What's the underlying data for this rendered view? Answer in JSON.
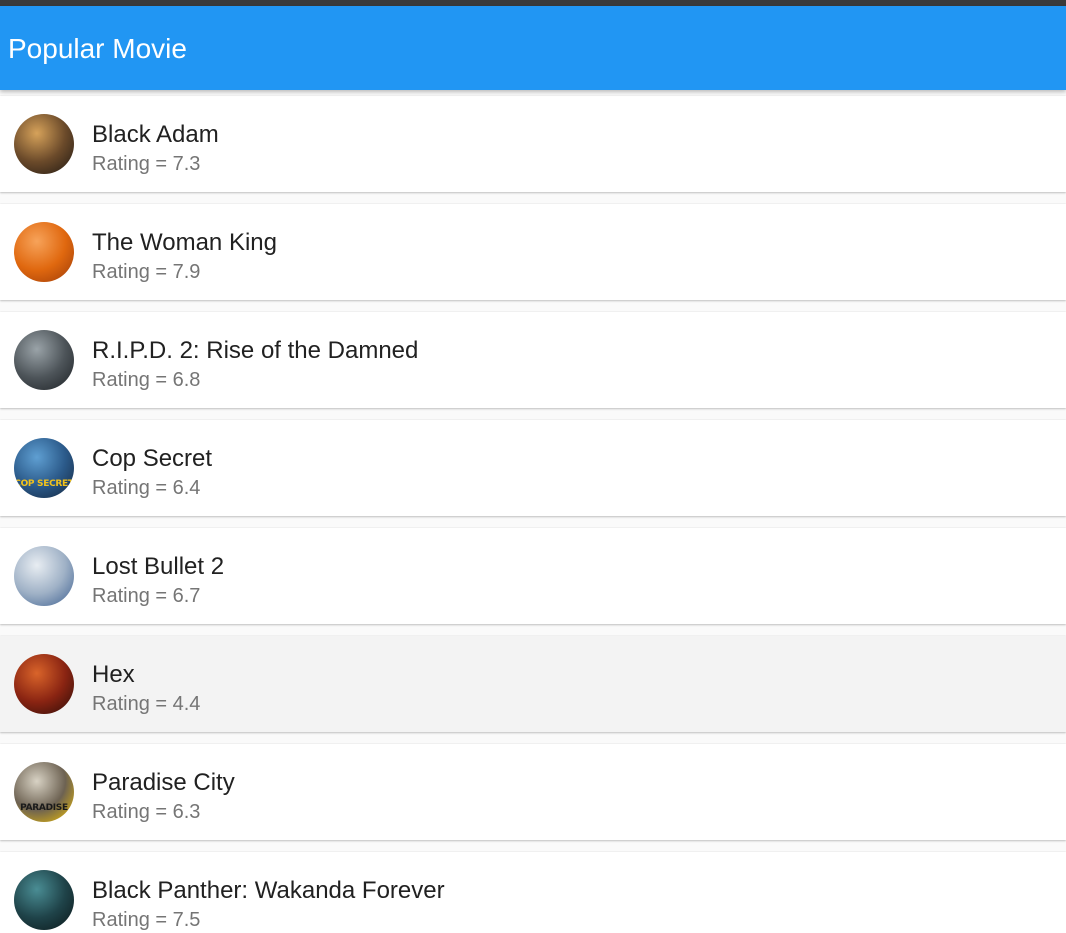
{
  "app_bar": {
    "title": "Popular Movie",
    "color": "#2196f3"
  },
  "movies": [
    {
      "title": "Black Adam",
      "rating_prefix": "Rating = ",
      "rating": "7.3",
      "poster_icon": "movie-poster-black-adam",
      "poster_colors": [
        "#d6a25a",
        "#6b4a2a",
        "#1e1712"
      ]
    },
    {
      "title": "The Woman King",
      "rating_prefix": "Rating = ",
      "rating": "7.9",
      "poster_icon": "movie-poster-the-woman-king",
      "poster_colors": [
        "#f7a35a",
        "#e0680f",
        "#9c3a08"
      ]
    },
    {
      "title": "R.I.P.D. 2: Rise of the Damned",
      "rating_prefix": "Rating = ",
      "rating": "6.8",
      "poster_icon": "movie-poster-ripd-2",
      "poster_colors": [
        "#9aa3a8",
        "#4d5459",
        "#1c2024"
      ]
    },
    {
      "title": "Cop Secret",
      "rating_prefix": "Rating = ",
      "rating": "6.4",
      "poster_icon": "movie-poster-cop-secret",
      "poster_colors": [
        "#5f9fd2",
        "#2b5a8a",
        "#14253d"
      ],
      "poster_text": "COP SECRET",
      "poster_text_color": "#f3c21b"
    },
    {
      "title": "Lost Bullet 2",
      "rating_prefix": "Rating = ",
      "rating": "6.7",
      "poster_icon": "movie-poster-lost-bullet-2",
      "poster_colors": [
        "#e8edf2",
        "#9fb1c6",
        "#3b5e8f"
      ]
    },
    {
      "title": "Hex",
      "rating_prefix": "Rating = ",
      "rating": "4.4",
      "poster_icon": "movie-poster-hex",
      "poster_colors": [
        "#d9642a",
        "#8a2412",
        "#2a0c08"
      ],
      "highlighted": true
    },
    {
      "title": "Paradise City",
      "rating_prefix": "Rating = ",
      "rating": "6.3",
      "poster_icon": "movie-poster-paradise-city",
      "poster_colors": [
        "#d8d2c4",
        "#6d6252",
        "#f5c400"
      ],
      "poster_text": "PARADISE",
      "poster_text_color": "#1a1a1a"
    },
    {
      "title": "Black Panther: Wakanda Forever",
      "rating_prefix": "Rating = ",
      "rating": "7.5",
      "poster_icon": "movie-poster-black-panther-wakanda-forever",
      "poster_colors": [
        "#4a8d94",
        "#1f4349",
        "#0b1618"
      ]
    }
  ]
}
